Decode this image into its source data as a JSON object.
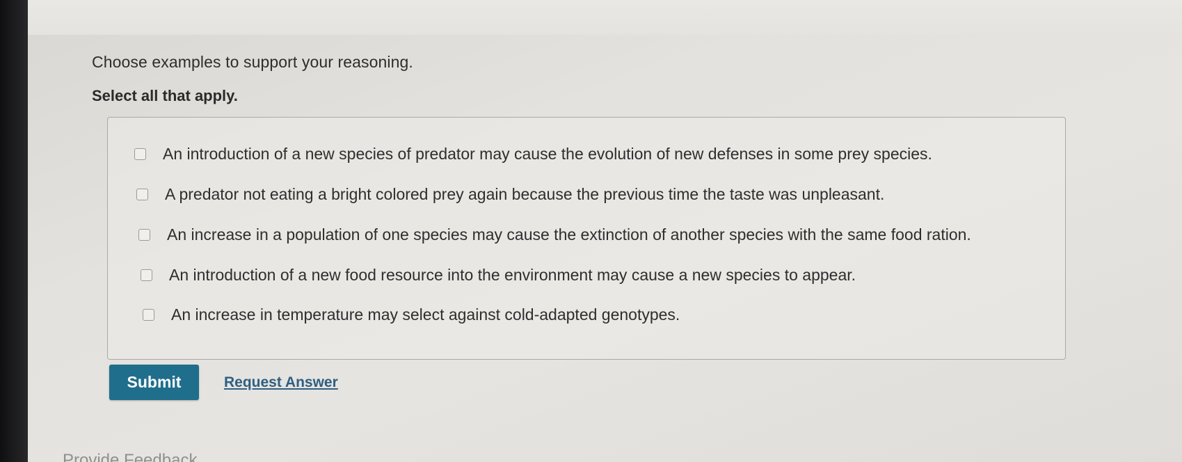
{
  "question": {
    "prompt": "Choose examples to support your reasoning.",
    "instruction": "Select all that apply."
  },
  "options": [
    {
      "label": "An introduction of a new species of predator may cause the evolution of new defenses in some prey species.",
      "checked": false
    },
    {
      "label": "A predator not eating a bright colored prey again because the previous time the taste was unpleasant.",
      "checked": false
    },
    {
      "label": "An increase in a population of one species may cause the extinction of another species with the same food ration.",
      "checked": false
    },
    {
      "label": "An introduction of a new food resource into the environment may cause a new species to appear.",
      "checked": false
    },
    {
      "label": "An increase in temperature may select against cold-adapted genotypes.",
      "checked": false
    }
  ],
  "actions": {
    "submit_label": "Submit",
    "request_answer_label": "Request Answer"
  },
  "footer": {
    "feedback_label": "Provide Feedback"
  },
  "colors": {
    "submit_bg": "#1f6e8c",
    "link": "#2f5f82"
  }
}
